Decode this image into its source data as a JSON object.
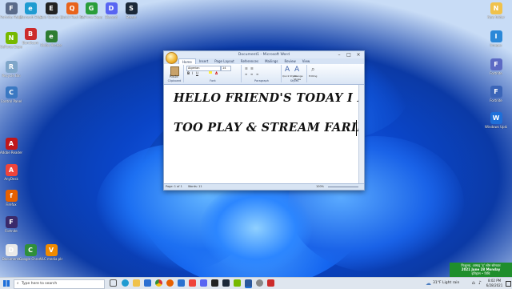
{
  "desktop": {
    "icons_left": [
      {
        "label": "Fortnite Pelga",
        "color": "#5a6b8a",
        "glyph": "F"
      },
      {
        "label": "Microsoft Edge",
        "color": "#1f9bd1",
        "glyph": "e"
      },
      {
        "label": "Epic Games Launcher",
        "color": "#222222",
        "glyph": "E"
      },
      {
        "label": "Quick Heal Antivirus",
        "color": "#e8631c",
        "glyph": "Q"
      },
      {
        "label": "GeForce Experience",
        "color": "#2a9d3a",
        "glyph": "G"
      },
      {
        "label": "Discord",
        "color": "#5865f2",
        "glyph": "D"
      },
      {
        "label": "Steam",
        "color": "#1b2838",
        "glyph": "S"
      },
      {
        "label": "Bandicam",
        "color": "#cc2b2b",
        "glyph": "B"
      },
      {
        "label": "Dolby Access",
        "color": "#2e7d32",
        "glyph": "e"
      },
      {
        "label": "GeForce Experience",
        "color": "#76b900",
        "glyph": "N"
      },
      {
        "label": "Recycle Bin",
        "color": "#7fa6c9",
        "glyph": "R"
      },
      {
        "label": "Control Panel",
        "color": "#3a78c2",
        "glyph": "C"
      },
      {
        "label": "Adobe Reader",
        "color": "#c0171b",
        "glyph": "A"
      },
      {
        "label": "AnyDesk",
        "color": "#ef443b",
        "glyph": "A"
      },
      {
        "label": "Firefox",
        "color": "#e66000",
        "glyph": "f"
      },
      {
        "label": "Fortnite",
        "color": "#3a2a6b",
        "glyph": "F"
      },
      {
        "label": "Documents",
        "color": "#e9e9e9",
        "glyph": "D"
      },
      {
        "label": "Google Chrome",
        "color": "#2f8f3a",
        "glyph": "C"
      },
      {
        "label": "VLC media player",
        "color": "#f08a00",
        "glyph": "V"
      }
    ],
    "icons_right": [
      {
        "label": "New folder",
        "color": "#f0c24b",
        "glyph": "N"
      },
      {
        "label": "Images",
        "color": "#2b88d8",
        "glyph": "I"
      },
      {
        "label": "Fortnite",
        "color": "#5c6ac4",
        "glyph": "F"
      },
      {
        "label": "Fortnite",
        "color": "#3b65b8",
        "glyph": "F"
      },
      {
        "label": "Windows Update",
        "color": "#1e6fd9",
        "glyph": "W"
      }
    ]
  },
  "word": {
    "title": "Document1 - Microsoft Word",
    "tabs": [
      "Home",
      "Insert",
      "Page Layout",
      "References",
      "Mailings",
      "Review",
      "View"
    ],
    "font_name": "Algerian",
    "font_size": "14",
    "group_labels": [
      "Clipboard",
      "Font",
      "Paragraph",
      "Styles",
      "Editing"
    ],
    "paste_label": "Paste",
    "styles": [
      "Quick Styles",
      "Change Styles",
      "Editing"
    ],
    "lines": [
      "HELLO FRIEND'S TODAY I BOUGHT",
      "TOO PLAY & STREAM FARIEND"
    ],
    "status_page": "Page: 1 of 1",
    "status_words": "Words: 11",
    "zoom": "100%"
  },
  "taskbar": {
    "search_placeholder": "Type here to search",
    "weather": "31°F Light rain",
    "time": "8:02 PM",
    "date": "6/28/2021"
  },
  "notice": {
    "line1": "निःशुल्क, आषाढ़ 'ह' सोम सोमवार",
    "line2": "2021 June 28 Monday",
    "line3": "इतिहास • तिथि"
  },
  "colors": {
    "accent": "#1e6dff",
    "word_blue": "#dfe8f5",
    "taskbar": "#dfe6ef"
  }
}
